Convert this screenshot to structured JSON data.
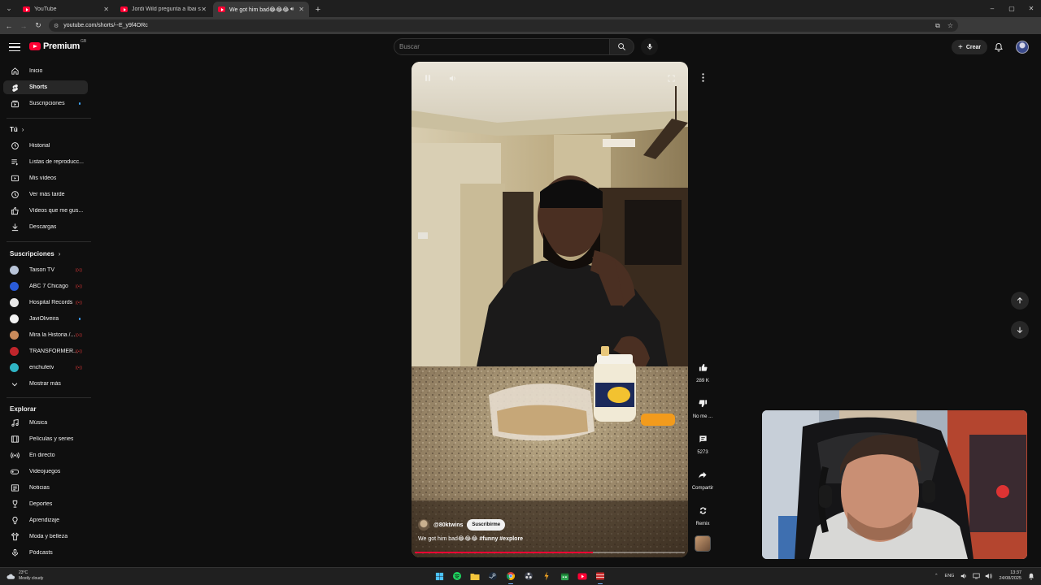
{
  "browser": {
    "tabs": [
      {
        "title": "YouTube",
        "active": false
      },
      {
        "title": "Jordi Wild pregunta a Ibai si es",
        "active": false
      },
      {
        "title": "We got him bad😂😂😂 #",
        "active": true
      }
    ],
    "url": "youtube.com/shorts/--E_y9f4ORc",
    "window_controls": {
      "minimize": "–",
      "maximize": "▢",
      "close": "✕"
    }
  },
  "masthead": {
    "logo_text": "Premium",
    "country_code": "GB",
    "search_placeholder": "Buscar",
    "create_label": "Crear"
  },
  "sidebar": {
    "main": [
      {
        "label": "Inicio",
        "icon": "home-icon"
      },
      {
        "label": "Shorts",
        "icon": "shorts-icon",
        "active": true
      },
      {
        "label": "Suscripciones",
        "icon": "subscriptions-icon",
        "dot": true
      }
    ],
    "you_header": "Tú",
    "you": [
      {
        "label": "Historial",
        "icon": "history-icon"
      },
      {
        "label": "Listas de reproducc...",
        "icon": "playlists-icon"
      },
      {
        "label": "Mis vídeos",
        "icon": "my-videos-icon"
      },
      {
        "label": "Ver más tarde",
        "icon": "watch-later-icon"
      },
      {
        "label": "Vídeos que me gus...",
        "icon": "liked-icon"
      },
      {
        "label": "Descargas",
        "icon": "downloads-icon"
      }
    ],
    "subs_header": "Suscripciones",
    "subscriptions": [
      {
        "label": "Taison TV",
        "color": "#b8c4d8",
        "badge": "live"
      },
      {
        "label": "ABC 7 Chicago",
        "color": "#2a5bd7",
        "badge": "live"
      },
      {
        "label": "Hospital Records",
        "color": "#e8e8e8",
        "badge": "live"
      },
      {
        "label": "JaviOliveira",
        "color": "#f2f2f2",
        "badge": "dot"
      },
      {
        "label": "Mira la Historia /...",
        "color": "#c98a5a",
        "badge": "live"
      },
      {
        "label": "TRANSFORMER...",
        "color": "#c0252b",
        "badge": "live"
      },
      {
        "label": "enchufetv",
        "color": "#2fb4c4",
        "badge": "live"
      }
    ],
    "show_more": "Mostrar más",
    "explore_header": "Explorar",
    "explore": [
      {
        "label": "Música",
        "icon": "music-icon"
      },
      {
        "label": "Películas y series",
        "icon": "movies-icon"
      },
      {
        "label": "En directo",
        "icon": "live-icon"
      },
      {
        "label": "Videojuegos",
        "icon": "gaming-icon"
      },
      {
        "label": "Noticias",
        "icon": "news-icon"
      },
      {
        "label": "Deportes",
        "icon": "sports-icon"
      },
      {
        "label": "Aprendizaje",
        "icon": "learning-icon"
      },
      {
        "label": "Moda y belleza",
        "icon": "fashion-icon"
      },
      {
        "label": "Pódcasts",
        "icon": "podcasts-icon"
      }
    ]
  },
  "short": {
    "channel_handle": "@80ktwins",
    "subscribe_label": "Suscribirme",
    "caption_text": "We got him bad😂😂😂 ",
    "caption_tags": "#funny #explore",
    "progress": 0.66
  },
  "actions": {
    "likes": "289 K",
    "dislike_label": "No me ...",
    "comments": "5273",
    "share_label": "Compartir",
    "remix_label": "Remix"
  },
  "taskbar": {
    "weather_temp": "23°C",
    "weather_desc": "Mostly cloudy",
    "language": "ENG",
    "time": "13:37",
    "date": "24/08/2025"
  }
}
